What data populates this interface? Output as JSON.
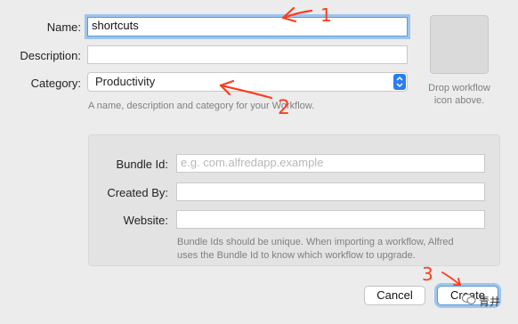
{
  "form": {
    "name_label": "Name:",
    "name_value": "shortcuts",
    "description_label": "Description:",
    "description_value": "",
    "category_label": "Category:",
    "category_value": "Productivity",
    "hint": "A name, description and category for your Workflow."
  },
  "icon_drop": {
    "line1": "Drop workflow",
    "line2": "icon above."
  },
  "bundle": {
    "bundle_id_label": "Bundle Id:",
    "bundle_id_placeholder": "e.g. com.alfredapp.example",
    "created_by_label": "Created By:",
    "website_label": "Website:",
    "hint_line1": "Bundle Ids should be unique. When importing a workflow, Alfred",
    "hint_line2": "uses the Bundle Id to know which workflow to upgrade."
  },
  "buttons": {
    "cancel": "Cancel",
    "create": "Create"
  },
  "annotations": {
    "n1": "1",
    "n2": "2",
    "n3": "3",
    "color": "#ff3b1f"
  },
  "watermark": "青井"
}
